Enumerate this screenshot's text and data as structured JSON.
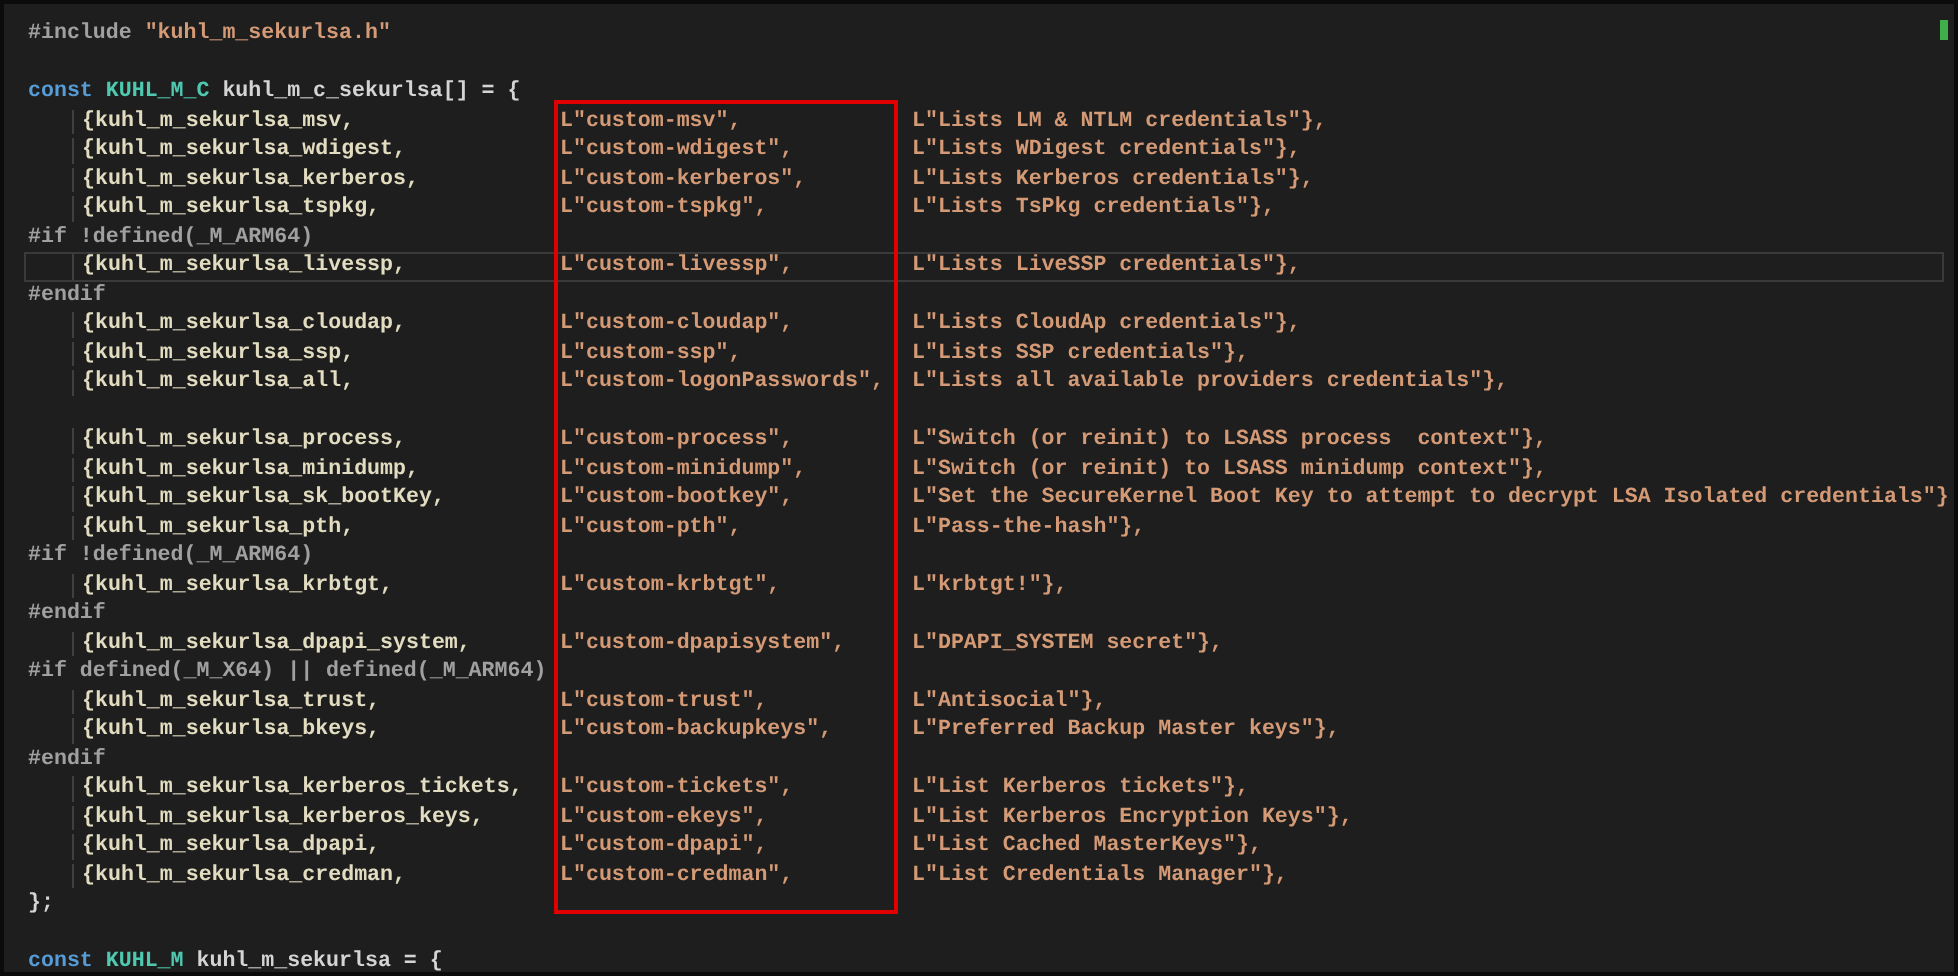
{
  "editor": {
    "lines": [
      {
        "kind": "code",
        "tokens": [
          {
            "text": "#include",
            "kind": "preprocessor"
          },
          {
            "text": "\"kuhl_m_sekurlsa.h\"",
            "kind": "string"
          }
        ]
      },
      {
        "kind": "blank"
      },
      {
        "kind": "code",
        "tokens": [
          {
            "text": "const",
            "kind": "keyword"
          },
          {
            "text": "KUHL_M_C",
            "kind": "type"
          },
          {
            "text": "kuhl_m_c_sekurlsa[]",
            "kind": "plain"
          },
          {
            "text": "=",
            "kind": "plain"
          },
          {
            "text": "{",
            "kind": "plain"
          }
        ]
      },
      {
        "kind": "entry",
        "current": false,
        "symbol": "{kuhl_m_sekurlsa_msv,",
        "name": "L\"custom-msv\",",
        "description": "L\"Lists LM & NTLM credentials\"},"
      },
      {
        "kind": "entry",
        "current": false,
        "symbol": "{kuhl_m_sekurlsa_wdigest,",
        "name": "L\"custom-wdigest\",",
        "description": "L\"Lists WDigest credentials\"},"
      },
      {
        "kind": "entry",
        "current": false,
        "symbol": "{kuhl_m_sekurlsa_kerberos,",
        "name": "L\"custom-kerberos\",",
        "description": "L\"Lists Kerberos credentials\"},"
      },
      {
        "kind": "entry",
        "current": false,
        "symbol": "{kuhl_m_sekurlsa_tspkg,",
        "name": "L\"custom-tspkg\",",
        "description": "L\"Lists TsPkg credentials\"},"
      },
      {
        "kind": "code",
        "tokens": [
          {
            "text": "#if",
            "kind": "preprocessor"
          },
          {
            "text": "!defined(_M_ARM64)",
            "kind": "preprocessor"
          }
        ]
      },
      {
        "kind": "entry",
        "current": true,
        "symbol": "{kuhl_m_sekurlsa_livessp,",
        "name": "L\"custom-livessp\",",
        "description": "L\"Lists LiveSSP credentials\"},"
      },
      {
        "kind": "code",
        "tokens": [
          {
            "text": "#endif",
            "kind": "preprocessor"
          }
        ]
      },
      {
        "kind": "entry",
        "current": false,
        "symbol": "{kuhl_m_sekurlsa_cloudap,",
        "name": "L\"custom-cloudap\",",
        "description": "L\"Lists CloudAp credentials\"},"
      },
      {
        "kind": "entry",
        "current": false,
        "symbol": "{kuhl_m_sekurlsa_ssp,",
        "name": "L\"custom-ssp\",",
        "description": "L\"Lists SSP credentials\"},"
      },
      {
        "kind": "entry",
        "current": false,
        "symbol": "{kuhl_m_sekurlsa_all,",
        "name": "L\"custom-logonPasswords\",",
        "description": "L\"Lists all available providers credentials\"},"
      },
      {
        "kind": "blank"
      },
      {
        "kind": "entry",
        "current": false,
        "symbol": "{kuhl_m_sekurlsa_process,",
        "name": "L\"custom-process\",",
        "description": "L\"Switch (or reinit) to LSASS process  context\"},"
      },
      {
        "kind": "entry",
        "current": false,
        "symbol": "{kuhl_m_sekurlsa_minidump,",
        "name": "L\"custom-minidump\",",
        "description": "L\"Switch (or reinit) to LSASS minidump context\"},"
      },
      {
        "kind": "entry",
        "current": false,
        "symbol": "{kuhl_m_sekurlsa_sk_bootKey,",
        "name": "L\"custom-bootkey\",",
        "description": "L\"Set the SecureKernel Boot Key to attempt to decrypt LSA Isolated credentials\"}"
      },
      {
        "kind": "entry",
        "current": false,
        "symbol": "{kuhl_m_sekurlsa_pth,",
        "name": "L\"custom-pth\",",
        "description": "L\"Pass-the-hash\"},"
      },
      {
        "kind": "code",
        "tokens": [
          {
            "text": "#if",
            "kind": "preprocessor"
          },
          {
            "text": "!defined(_M_ARM64)",
            "kind": "preprocessor"
          }
        ]
      },
      {
        "kind": "entry",
        "current": false,
        "symbol": "{kuhl_m_sekurlsa_krbtgt,",
        "name": "L\"custom-krbtgt\",",
        "description": "L\"krbtgt!\"},"
      },
      {
        "kind": "code",
        "tokens": [
          {
            "text": "#endif",
            "kind": "preprocessor"
          }
        ]
      },
      {
        "kind": "entry",
        "current": false,
        "symbol": "{kuhl_m_sekurlsa_dpapi_system,",
        "name": "L\"custom-dpapisystem\",",
        "description": "L\"DPAPI_SYSTEM secret\"},"
      },
      {
        "kind": "code",
        "tokens": [
          {
            "text": "#if",
            "kind": "preprocessor"
          },
          {
            "text": "defined(_M_X64)",
            "kind": "preprocessor"
          },
          {
            "text": "||",
            "kind": "preprocessor"
          },
          {
            "text": "defined(_M_ARM64)",
            "kind": "preprocessor"
          }
        ]
      },
      {
        "kind": "entry",
        "current": false,
        "symbol": "{kuhl_m_sekurlsa_trust,",
        "name": "L\"custom-trust\",",
        "description": "L\"Antisocial\"},"
      },
      {
        "kind": "entry",
        "current": false,
        "symbol": "{kuhl_m_sekurlsa_bkeys,",
        "name": "L\"custom-backupkeys\",",
        "description": "L\"Preferred Backup Master keys\"},"
      },
      {
        "kind": "code",
        "tokens": [
          {
            "text": "#endif",
            "kind": "preprocessor"
          }
        ]
      },
      {
        "kind": "entry",
        "current": false,
        "symbol": "{kuhl_m_sekurlsa_kerberos_tickets,",
        "name": "L\"custom-tickets\",",
        "description": "L\"List Kerberos tickets\"},"
      },
      {
        "kind": "entry",
        "current": false,
        "symbol": "{kuhl_m_sekurlsa_kerberos_keys,",
        "name": "L\"custom-ekeys\",",
        "description": "L\"List Kerberos Encryption Keys\"},"
      },
      {
        "kind": "entry",
        "current": false,
        "symbol": "{kuhl_m_sekurlsa_dpapi,",
        "name": "L\"custom-dpapi\",",
        "description": "L\"List Cached MasterKeys\"},"
      },
      {
        "kind": "entry",
        "current": false,
        "symbol": "{kuhl_m_sekurlsa_credman,",
        "name": "L\"custom-credman\",",
        "description": "L\"List Credentials Manager\"},"
      },
      {
        "kind": "code",
        "tokens": [
          {
            "text": "};",
            "kind": "plain"
          }
        ]
      },
      {
        "kind": "blank"
      },
      {
        "kind": "code",
        "tokens": [
          {
            "text": "const",
            "kind": "keyword"
          },
          {
            "text": "KUHL_M",
            "kind": "type"
          },
          {
            "text": "kuhl_m_sekurlsa",
            "kind": "plain"
          },
          {
            "text": "=",
            "kind": "plain"
          },
          {
            "text": "{",
            "kind": "plain"
          }
        ]
      }
    ],
    "annotation": {
      "kind": "rectangle"
    }
  }
}
